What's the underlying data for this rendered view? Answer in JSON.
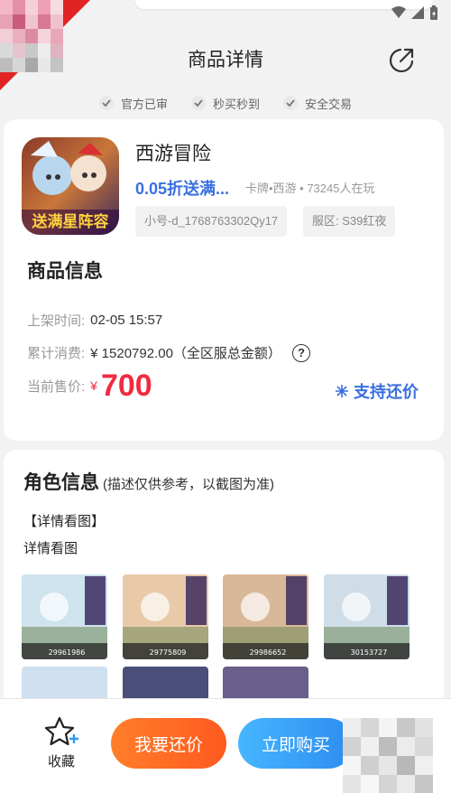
{
  "header": {
    "title": "商品详情"
  },
  "guarantees": [
    "官方已审",
    "秒买秒到",
    "安全交易"
  ],
  "product": {
    "game_name": "西游冒险",
    "promo": "0.05折送满...",
    "meta": "卡牌•西游 • 73245人在玩",
    "account_tag": "小号-d_1768763302Qy17",
    "server_tag": "服区: S39红夜",
    "icon_text": "送满星阵容"
  },
  "goods_info": {
    "title": "商品信息",
    "listed_label": "上架时间:",
    "listed_value": "02-05 15:57",
    "spend_label": "累计消费:",
    "spend_value": "¥ 1520792.00（全区服总金额）",
    "help_mark": "?",
    "price_label": "当前售价:",
    "price_currency": "¥",
    "price_value": "700",
    "bargain_link": "支持还价"
  },
  "role_info": {
    "title": "角色信息",
    "note": "(描述仅供参考，以截图为准)",
    "detail_heading": "【详情看图】",
    "detail_sub": "详情看图",
    "thumbnails": [
      {
        "label": "29961986",
        "tone": "#cfe3ee"
      },
      {
        "label": "29775809",
        "tone": "#e8c9a8"
      },
      {
        "label": "29986652",
        "tone": "#d9b89a"
      },
      {
        "label": "30153727",
        "tone": "#cfdde8"
      }
    ]
  },
  "bottom_bar": {
    "fav_label": "收藏",
    "bargain_button": "我要还价",
    "buy_button": "立即购买"
  },
  "colors": {
    "accent_blue": "#3a6fe0",
    "price_red": "#f02b3f",
    "orange": "#ff6a22",
    "blue_button": "#3a9cf5"
  }
}
